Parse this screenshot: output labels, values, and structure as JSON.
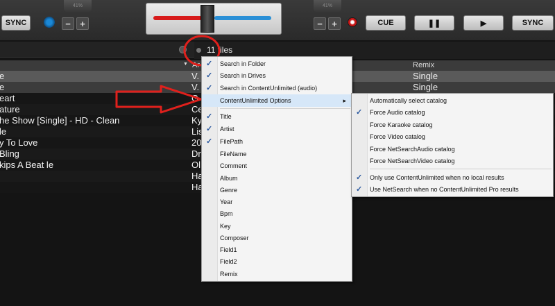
{
  "deck_left": {
    "sync_label": "SYNC",
    "pitch_label": "41%",
    "minus": "−",
    "plus": "+"
  },
  "deck_right": {
    "pitch_label": "41%",
    "minus": "−",
    "plus": "+",
    "cue_label": "CUE",
    "pause_label": "❚❚",
    "play_label": "▶",
    "sync_label": "SYNC"
  },
  "browser": {
    "file_count": "11 files",
    "columns": {
      "artist": "Ar",
      "remix": "Remix"
    },
    "rows": [
      {
        "title": "e",
        "artist": "V.",
        "remix": "Single"
      },
      {
        "title": "e",
        "artist": "V.",
        "remix": "Single"
      },
      {
        "title": "eart",
        "artist": "G",
        "remix": ""
      },
      {
        "title": "ature",
        "artist": "Ce",
        "remix": ""
      },
      {
        "title": "he Show [Single] - HD - Clean",
        "artist": "Ky",
        "remix": ""
      },
      {
        "title": "le",
        "artist": "Lis",
        "remix": ""
      },
      {
        "title": "y To Love",
        "artist": "20",
        "remix": ""
      },
      {
        "title": "Bling",
        "artist": "Dr",
        "remix": ""
      },
      {
        "title": "kips A Beat le",
        "artist": "Ol",
        "remix": ""
      },
      {
        "title": "",
        "artist": "Ha",
        "remix": ""
      },
      {
        "title": "",
        "artist": "Ha",
        "remix": ""
      }
    ]
  },
  "menu": {
    "items": [
      {
        "label": "Search in Folder",
        "checked": true
      },
      {
        "label": "Search in Drives",
        "checked": true
      },
      {
        "label": "Search in ContentUnlimited (audio)",
        "checked": true
      },
      {
        "label": "ContentUnlimited Options",
        "checked": false,
        "submenu": true
      },
      {
        "label": "Title",
        "checked": true
      },
      {
        "label": "Artist",
        "checked": true
      },
      {
        "label": "FilePath",
        "checked": true
      },
      {
        "label": "FileName",
        "checked": false
      },
      {
        "label": "Comment",
        "checked": false
      },
      {
        "label": "Album",
        "checked": false
      },
      {
        "label": "Genre",
        "checked": false
      },
      {
        "label": "Year",
        "checked": false
      },
      {
        "label": "Bpm",
        "checked": false
      },
      {
        "label": "Key",
        "checked": false
      },
      {
        "label": "Composer",
        "checked": false
      },
      {
        "label": "Field1",
        "checked": false
      },
      {
        "label": "Field2",
        "checked": false
      },
      {
        "label": "Remix",
        "checked": false
      }
    ]
  },
  "submenu": {
    "items": [
      {
        "label": "Automatically select catalog",
        "checked": false
      },
      {
        "label": "Force Audio catalog",
        "checked": true
      },
      {
        "label": "Force Karaoke catalog",
        "checked": false
      },
      {
        "label": "Force Video catalog",
        "checked": false
      },
      {
        "label": "Force NetSearchAudio catalog",
        "checked": false
      },
      {
        "label": "Force NetSearchVideo catalog",
        "checked": false
      },
      {
        "label": "Only use ContentUnlimited when no local results",
        "checked": true
      },
      {
        "label": "Use NetSearch when no ContentUnlimited Pro results",
        "checked": true
      }
    ]
  },
  "check_glyph": "✓",
  "arrow_glyph": "▸",
  "colors": {
    "annotation": "#e0201c",
    "check": "#2c5aa0",
    "crossfader_left": "#d71a1a",
    "crossfader_right": "#2a8fd6"
  }
}
